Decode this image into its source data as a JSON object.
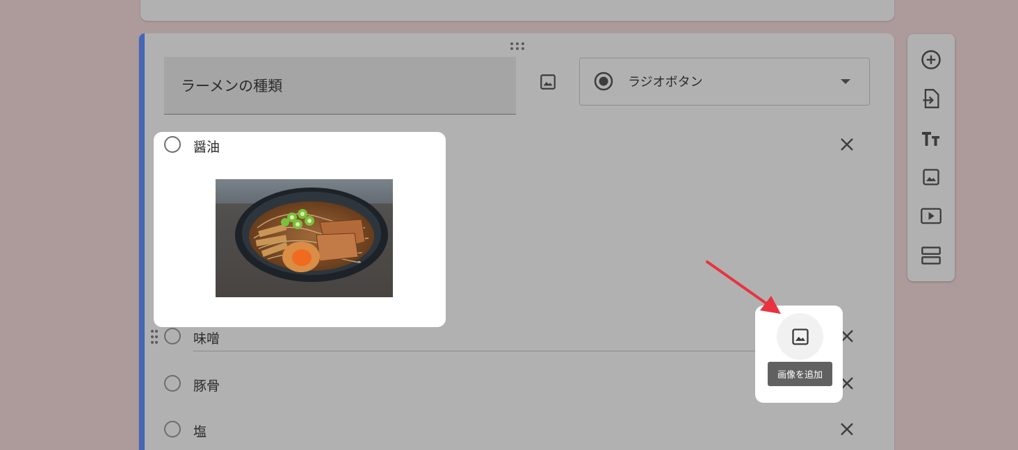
{
  "question": {
    "title": "ラーメンの種類",
    "type_label": "ラジオボタン"
  },
  "options": [
    {
      "label": "醤油"
    },
    {
      "label": "味噌"
    },
    {
      "label": "豚骨"
    },
    {
      "label": "塩"
    }
  ],
  "tooltip": {
    "add_image": "画像を追加"
  },
  "colors": {
    "accent": "#4366b7",
    "annotation_arrow": "#e8333f",
    "overlay_bg": "#ad9b9c"
  },
  "icons": {
    "toolbar": [
      "add-question-icon",
      "import-questions-icon",
      "add-title-icon",
      "add-image-icon",
      "add-video-icon",
      "add-section-icon"
    ]
  }
}
